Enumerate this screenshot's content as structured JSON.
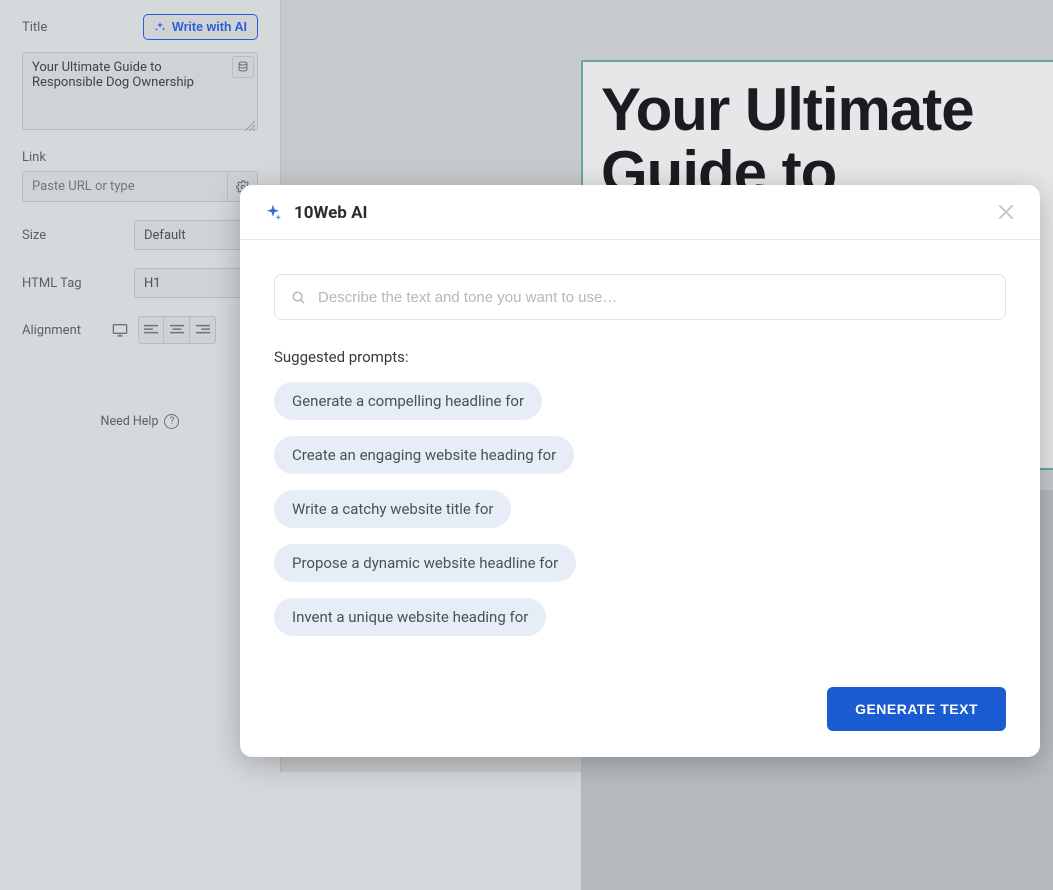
{
  "sidebar": {
    "title_label": "Title",
    "write_ai_label": "Write with AI",
    "title_value": "Your Ultimate Guide to Responsible Dog Ownership",
    "link_label": "Link",
    "link_placeholder": "Paste URL or type",
    "size_label": "Size",
    "size_value": "Default",
    "html_tag_label": "HTML Tag",
    "html_tag_value": "H1",
    "alignment_label": "Alignment",
    "need_help_label": "Need Help"
  },
  "preview": {
    "big_title": "Your Ultimate Guide to"
  },
  "modal": {
    "brand": "10Web AI",
    "prompt_placeholder": "Describe the text and tone you want to use…",
    "suggested_label": "Suggested prompts:",
    "chips": [
      "Generate a compelling headline for",
      "Create an engaging website heading for",
      "Write a catchy website title for",
      "Propose a dynamic website headline for",
      "Invent a unique website heading for"
    ],
    "generate_label": "GENERATE TEXT"
  },
  "colors": {
    "accent_blue": "#1a5bd1",
    "chip_bg": "#e6edf7",
    "preview_border": "#6aa89b"
  }
}
